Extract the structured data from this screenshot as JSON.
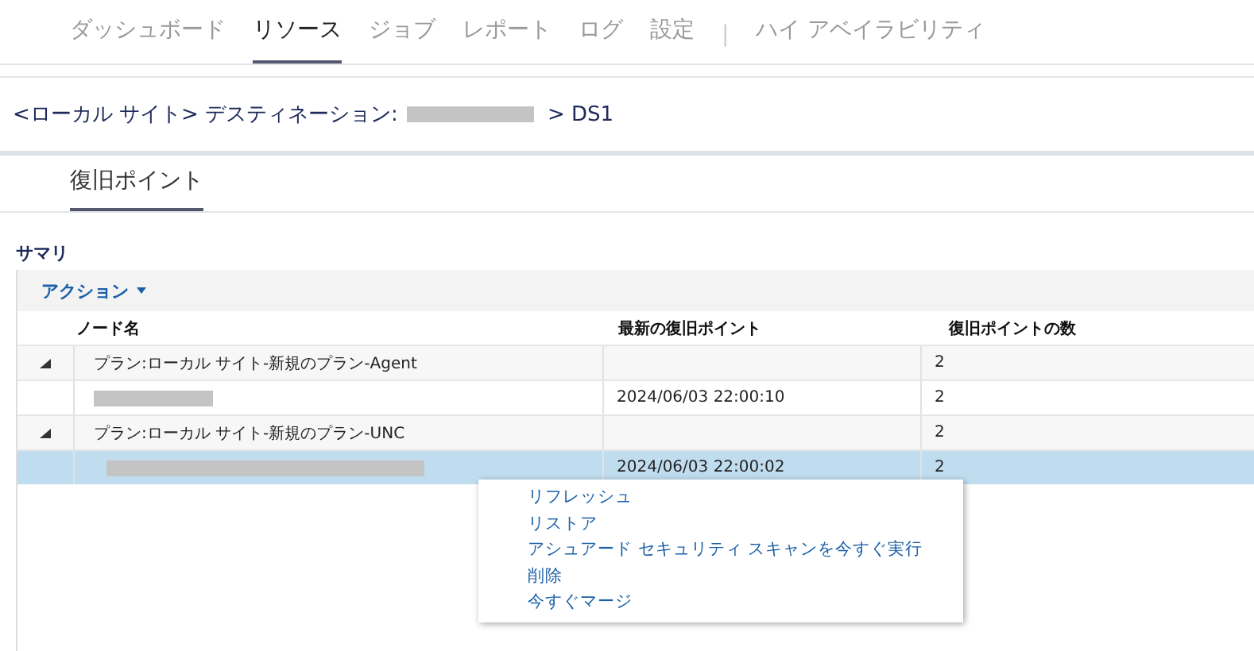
{
  "nav": {
    "tabs": [
      {
        "label": "ダッシュボード",
        "selected": false
      },
      {
        "label": "リソース",
        "selected": true
      },
      {
        "label": "ジョブ",
        "selected": false
      },
      {
        "label": "レポート",
        "selected": false
      },
      {
        "label": "ログ",
        "selected": false
      },
      {
        "label": "設定",
        "selected": false
      },
      {
        "label": "ハイ アベイラビリティ",
        "selected": false
      }
    ],
    "separator": "|"
  },
  "breadcrumb": {
    "prefix": "<ローカル サイト> デスティネーション:",
    "suffix": "> DS1"
  },
  "subtabs": [
    {
      "label": "復旧ポイント",
      "selected": true
    }
  ],
  "section_title": "サマリ",
  "toolbar": {
    "action_label": "アクション"
  },
  "table": {
    "columns": [
      "ノード名",
      "最新の復旧ポイント",
      "復旧ポイントの数"
    ],
    "rows": [
      {
        "kind": "group",
        "expanded": true,
        "name": "プラン:ローカル サイト-新規のプラン-Agent",
        "latest": "",
        "count": "2",
        "selected": false
      },
      {
        "kind": "item",
        "latest": "2024/06/03 22:00:10",
        "count": "2",
        "selected": false
      },
      {
        "kind": "group",
        "expanded": true,
        "name": "プラン:ローカル サイト-新規のプラン-UNC",
        "latest": "",
        "count": "2",
        "selected": false
      },
      {
        "kind": "item",
        "latest": "2024/06/03 22:00:02",
        "count": "2",
        "selected": true
      }
    ]
  },
  "context_menu": [
    "リフレッシュ",
    "リストア",
    "アシュアード セキュリティ スキャンを今すぐ実行",
    "削除",
    "今すぐマージ"
  ]
}
